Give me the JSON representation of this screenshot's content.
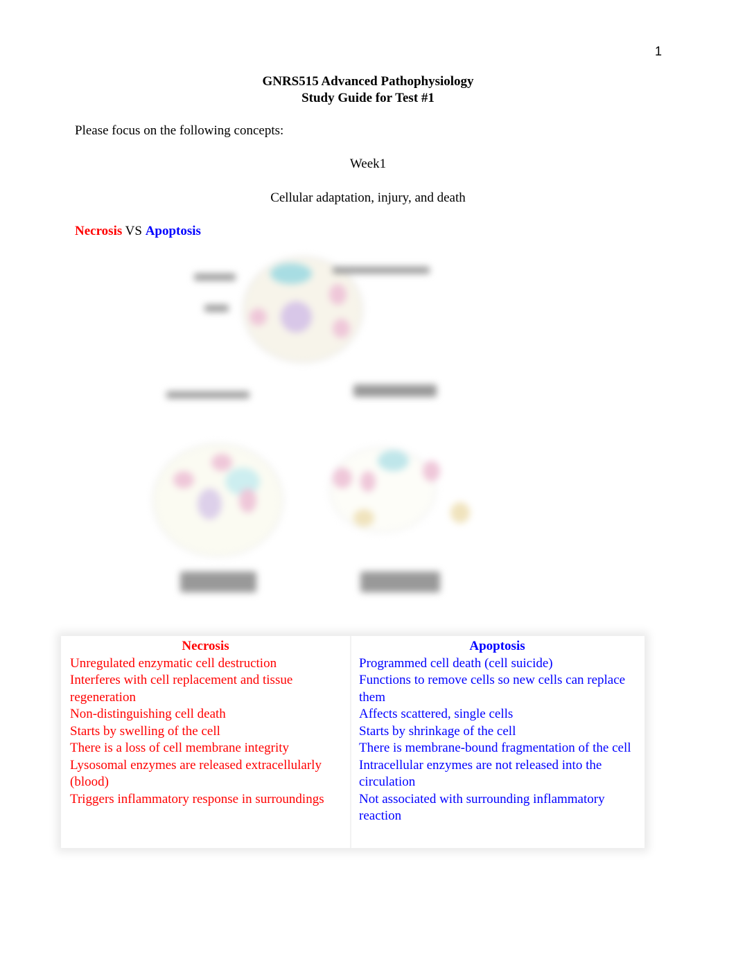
{
  "page_number": "1",
  "header": {
    "title_line1": "GNRS515 Advanced Pathophysiology",
    "title_line2": "Study Guide for Test #1"
  },
  "intro": "Please focus on the following concepts:",
  "week": "Week1",
  "topic": "Cellular adaptation, injury, and death",
  "section_heading": {
    "left": "Necrosis",
    "middle": " VS ",
    "right": "Apoptosis"
  },
  "colors": {
    "necrosis": "#ff0000",
    "apoptosis": "#0000ff"
  },
  "figure": {
    "description": "blurred-diagram-normal-cell-to-necrosis-and-apoptosis"
  },
  "comparison_table": {
    "headers": [
      "Necrosis",
      "Apoptosis"
    ],
    "rows": [
      [
        "Unregulated enzymatic cell destruction",
        "Programmed cell death (cell suicide)"
      ],
      [
        "Interferes with cell replacement and tissue regeneration",
        "Functions to remove cells so new cells can replace them"
      ],
      [
        "Non-distinguishing cell death",
        "Affects scattered, single cells"
      ],
      [
        "Starts by swelling of the cell",
        "Starts by shrinkage of the cell"
      ],
      [
        "There is a loss of cell membrane integrity",
        "There is membrane-bound fragmentation of the cell"
      ],
      [
        "Lysosomal enzymes are released extracellularly (blood)",
        "Intracellular enzymes are not released into the circulation"
      ],
      [
        "Triggers inflammatory response in surroundings",
        "Not associated with surrounding inflammatory reaction"
      ]
    ]
  }
}
